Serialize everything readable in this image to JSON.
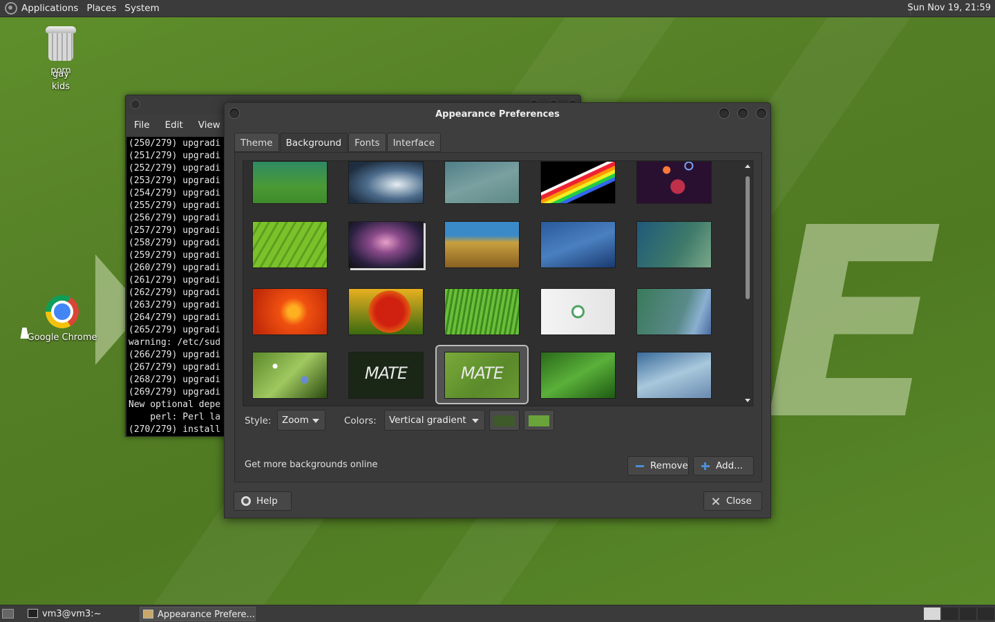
{
  "top_panel": {
    "menus": [
      "Applications",
      "Places",
      "System"
    ],
    "clock": "Sun Nov 19, 21:59"
  },
  "desktop": {
    "trash_label_lines": [
      "porn",
      "gay",
      "kids"
    ],
    "chrome_label": "Google Chrome"
  },
  "terminal": {
    "menus": [
      "File",
      "Edit",
      "View"
    ],
    "lines": [
      "(250/279) upgradi",
      "(251/279) upgradi",
      "(252/279) upgradi",
      "(253/279) upgradi",
      "(254/279) upgradi",
      "(255/279) upgradi",
      "(256/279) upgradi",
      "(257/279) upgradi",
      "(258/279) upgradi",
      "(259/279) upgradi",
      "(260/279) upgradi",
      "(261/279) upgradi",
      "(262/279) upgradi",
      "(263/279) upgradi",
      "(264/279) upgradi",
      "(265/279) upgradi",
      "warning: /etc/sud",
      "(266/279) upgradi",
      "(267/279) upgradi",
      "(268/279) upgradi",
      "(269/279) upgradi",
      "New optional depe",
      "    perl: Perl la",
      "(270/279) install"
    ]
  },
  "dialog": {
    "title": "Appearance Preferences",
    "tabs": [
      "Theme",
      "Background",
      "Fonts",
      "Interface"
    ],
    "active_tab": "Background",
    "mate_thumb_text": "MATE",
    "style_label": "Style:",
    "style_value": "Zoom",
    "colors_label": "Colors:",
    "colors_value": "Vertical gradient",
    "color_primary": "#3e5a2a",
    "color_secondary": "#6aa33a",
    "more_link": "Get more backgrounds online",
    "remove_button": "Remove",
    "add_button": "Add...",
    "help_button": "Help",
    "close_button": "Close"
  },
  "taskbar": {
    "items": [
      "vm3@vm3:~",
      "Appearance Prefere..."
    ]
  }
}
